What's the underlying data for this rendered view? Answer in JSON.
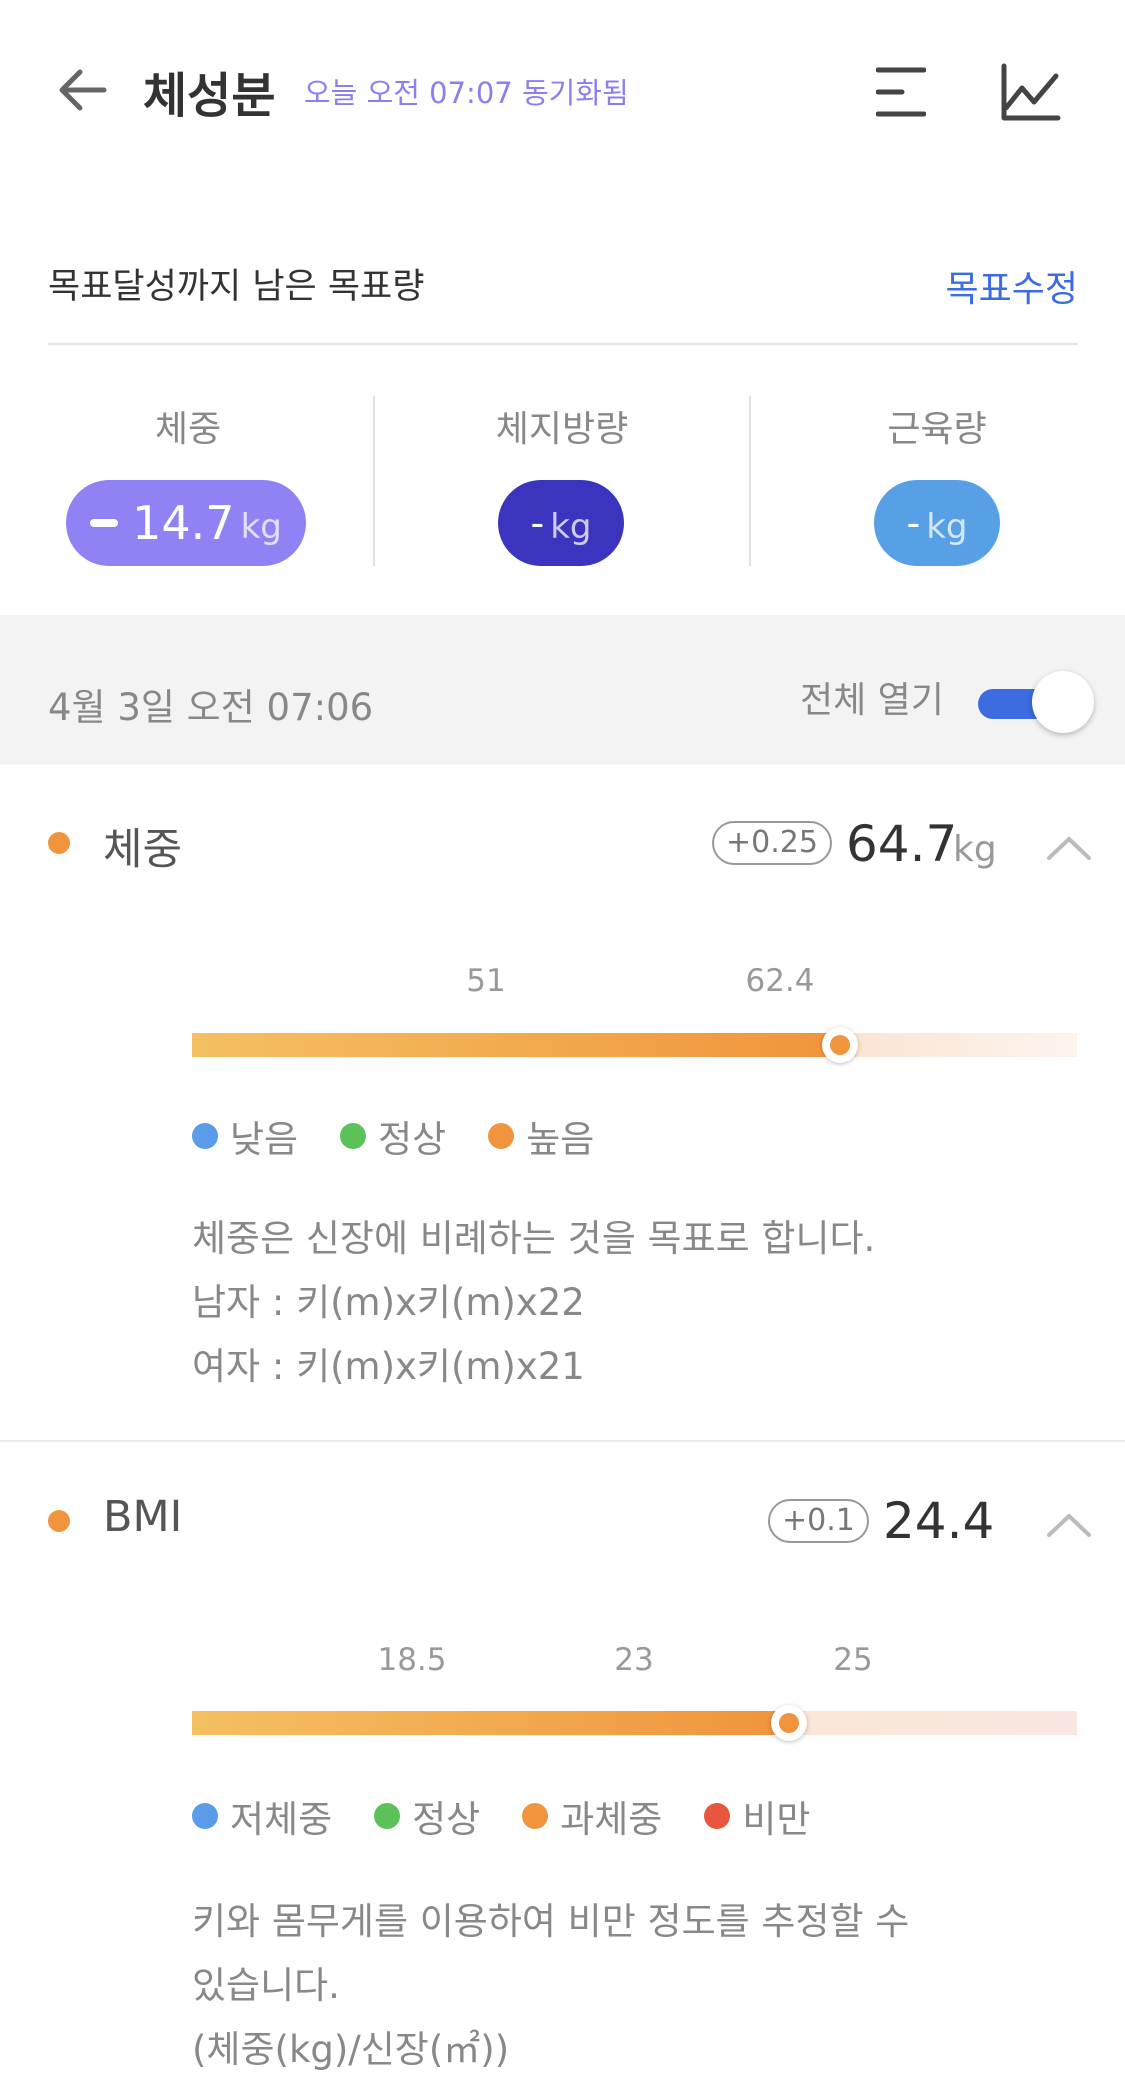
{
  "header": {
    "title": "체성분",
    "sync_status": "오늘 오전 07:07 동기화됨",
    "back_icon": "arrow-left-icon",
    "menu_icon": "menu-icon",
    "trend_icon": "line-chart-icon"
  },
  "goal": {
    "title": "목표달성까지 남은 목표량",
    "edit_label": "목표수정",
    "columns": [
      {
        "label": "체중",
        "value": "14.7",
        "unit": "kg",
        "color": "#8f82f5",
        "negative": true
      },
      {
        "label": "체지방량",
        "value": "-",
        "unit": "kg",
        "color": "#3a34bf",
        "negative": false
      },
      {
        "label": "근육량",
        "value": "-",
        "unit": "kg",
        "color": "#58a0e6",
        "negative": false
      }
    ]
  },
  "date_bar": {
    "date": "4월 3일 오전 07:06",
    "open_all_label": "전체 열기",
    "open_all_on": true,
    "toggle_color": "#3d6be0"
  },
  "weight": {
    "name": "체중",
    "status_color": "#f0953e",
    "delta": "+0.25",
    "value": "64.7",
    "unit": "kg",
    "ticks": [
      "51",
      "62.4"
    ],
    "legend": [
      {
        "label": "낮음",
        "color": "#5b9ce8"
      },
      {
        "label": "정상",
        "color": "#5cc159"
      },
      {
        "label": "높음",
        "color": "#f0953e"
      }
    ],
    "desc": [
      "체중은 신장에 비례하는 것을 목표로 합니다.",
      "남자 : 키(m)x키(m)x22",
      "여자 : 키(m)x키(m)x21"
    ]
  },
  "bmi": {
    "name": "BMI",
    "status_color": "#f0953e",
    "delta": "+0.1",
    "value": "24.4",
    "ticks": [
      "18.5",
      "23",
      "25"
    ],
    "legend": [
      {
        "label": "저체중",
        "color": "#5b9ce8"
      },
      {
        "label": "정상",
        "color": "#5cc159"
      },
      {
        "label": "과체중",
        "color": "#f0953e"
      },
      {
        "label": "비만",
        "color": "#e8563f"
      }
    ],
    "desc": [
      "키와 몸무게를 이용하여 비만 정도를 추정할 수",
      "있습니다.",
      "(체중(kg)/신장(㎡))"
    ]
  }
}
